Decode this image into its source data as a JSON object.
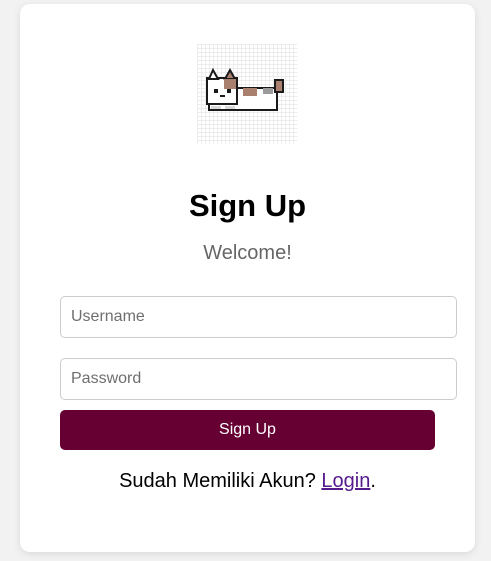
{
  "logo": {
    "icon": "pixel-cat-icon"
  },
  "heading": {
    "title": "Sign Up",
    "subtitle": "Welcome!"
  },
  "form": {
    "username_placeholder": "Username",
    "username_value": "",
    "password_placeholder": "Password",
    "password_value": "",
    "submit_label": "Sign Up"
  },
  "footer": {
    "prompt": "Sudah Memiliki Akun? ",
    "login_link": "Login",
    "trailing": "."
  },
  "colors": {
    "submit_background": "#660033",
    "link": "#551a8b"
  }
}
